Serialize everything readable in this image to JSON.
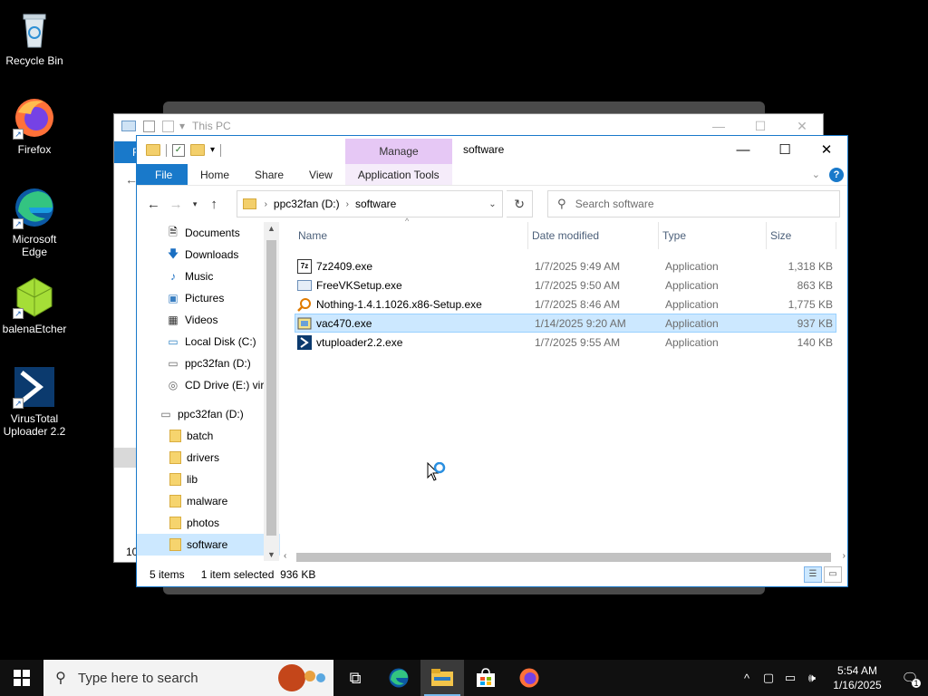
{
  "desktop": {
    "icons": [
      {
        "label": "Recycle Bin"
      },
      {
        "label": "Firefox"
      },
      {
        "label": "Microsoft Edge"
      },
      {
        "label": "balenaEtcher"
      },
      {
        "label": "VirusTotal Uploader 2.2"
      }
    ]
  },
  "bg_window": {
    "title": "This PC",
    "ribbon_tab_label": "F",
    "status_fragment": "10"
  },
  "window": {
    "title": "software",
    "manage_tab": "Manage",
    "ribbon_tabs": [
      "File",
      "Home",
      "Share",
      "View",
      "Application Tools"
    ],
    "controls": {
      "minimize": "—",
      "maximize": "☐",
      "close": "✕"
    },
    "address": {
      "crumbs": [
        "ppc32fan (D:)",
        "software"
      ]
    },
    "search_placeholder": "Search software",
    "nav_items": [
      {
        "label": "Documents",
        "icon": "documents-icon"
      },
      {
        "label": "Downloads",
        "icon": "downloads-icon"
      },
      {
        "label": "Music",
        "icon": "music-icon"
      },
      {
        "label": "Pictures",
        "icon": "pictures-icon"
      },
      {
        "label": "Videos",
        "icon": "videos-icon"
      },
      {
        "label": "Local Disk (C:)",
        "icon": "local-disk-icon"
      },
      {
        "label": "ppc32fan (D:)",
        "icon": "drive-icon"
      },
      {
        "label": "CD Drive (E:) virt",
        "icon": "cd-drive-icon"
      },
      {
        "label": "ppc32fan (D:)",
        "icon": "drive-icon"
      },
      {
        "label": "batch",
        "icon": "folder-icon"
      },
      {
        "label": "drivers",
        "icon": "folder-icon"
      },
      {
        "label": "lib",
        "icon": "folder-icon"
      },
      {
        "label": "malware",
        "icon": "folder-icon"
      },
      {
        "label": "photos",
        "icon": "folder-icon"
      },
      {
        "label": "software",
        "icon": "folder-icon"
      }
    ],
    "columns": [
      "Name",
      "Date modified",
      "Type",
      "Size"
    ],
    "files": [
      {
        "name": "7z2409.exe",
        "date": "1/7/2025 9:49 AM",
        "type": "Application",
        "size": "1,318 KB",
        "icon": "7zip-icon"
      },
      {
        "name": "FreeVKSetup.exe",
        "date": "1/7/2025 9:50 AM",
        "type": "Application",
        "size": "863 KB",
        "icon": "installer-icon"
      },
      {
        "name": "Nothing-1.4.1.1026.x86-Setup.exe",
        "date": "1/7/2025 8:46 AM",
        "type": "Application",
        "size": "1,775 KB",
        "icon": "magnifier-icon"
      },
      {
        "name": "vac470.exe",
        "date": "1/14/2025 9:20 AM",
        "type": "Application",
        "size": "937 KB",
        "icon": "setup-icon",
        "selected": true
      },
      {
        "name": "vtuploader2.2.exe",
        "date": "1/7/2025 9:55 AM",
        "type": "Application",
        "size": "140 KB",
        "icon": "virustotal-icon"
      }
    ],
    "status": {
      "items": "5 items",
      "selected": "1 item selected  936 KB"
    }
  },
  "taskbar": {
    "search_placeholder": "Type here to search",
    "time": "5:54 AM",
    "date": "1/16/2025",
    "notification_count": "1"
  },
  "colors": {
    "accent": "#1979ca",
    "selection": "#cce8ff",
    "manage_tab": "#e6c8f5"
  }
}
